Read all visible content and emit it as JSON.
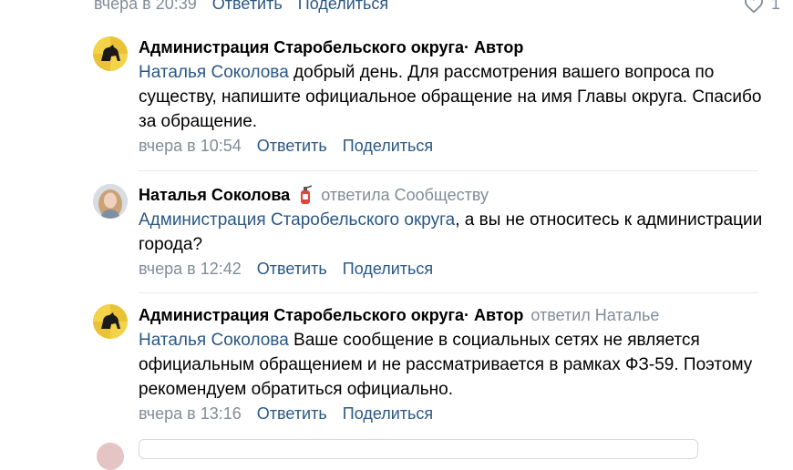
{
  "top": {
    "time": "вчера в 20:39",
    "reply": "Ответить",
    "share": "Поделиться",
    "likes_count": "1"
  },
  "comments": [
    {
      "author": "Администрация Старобельского округа",
      "author_suffix": " · Автор",
      "reply_to": "",
      "mention": "Наталья Соколова",
      "text": " добрый день. Для рассмотрения вашего вопроса по существу, напишите официальное обращение на имя Главы округа. Спасибо за обращение.",
      "time": "вчера в 10:54",
      "reply": "Ответить",
      "share": "Поделиться"
    },
    {
      "author": "Наталья Соколова",
      "author_suffix": "",
      "reply_to": "ответила Сообществу",
      "mention": "Администрация Старобельского округа",
      "text": ", а вы не относитесь к администрации города?",
      "time": "вчера в 12:42",
      "reply": "Ответить",
      "share": "Поделиться"
    },
    {
      "author": "Администрация Старобельского округа",
      "author_suffix": " · Автор",
      "reply_to": "ответил Наталье",
      "mention": "Наталья Соколова",
      "text": " Ваше сообщение в социальных сетях не является официальным обращением и не рассматривается в рамках ФЗ-59. Поэтому рекомендуем обратиться официально.",
      "time": "вчера в 13:16",
      "reply": "Ответить",
      "share": "Поделиться"
    }
  ],
  "colors": {
    "link": "#2a5885",
    "muted": "#818c99",
    "separator": "#e7e8ec",
    "admin_avatar_bg": "#f3d34a"
  },
  "icons": {
    "like": "heart-icon",
    "admin_avatar": "horse-emblem-icon",
    "user_badge": "fire-extinguisher-icon"
  }
}
